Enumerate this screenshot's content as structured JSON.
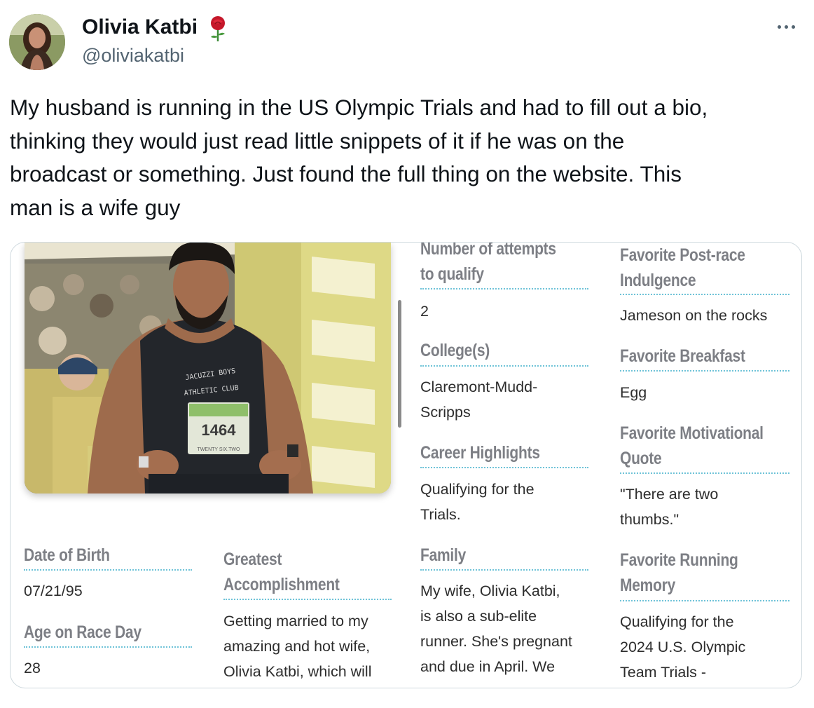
{
  "tweet": {
    "author": {
      "name": "Olivia Katbi",
      "handle": "@oliviakatbi",
      "name_emoji_icon": "rose-icon",
      "avatar_icon": "avatar-photo"
    },
    "more_icon": "ellipsis-icon",
    "text_lines": [
      "My husband is running in the US Olympic Trials and had to fill out a bio,",
      "thinking they would just read little snippets of it if he was on the",
      "broadcast or something. Just found the full thing on the website. This",
      "man is a wife guy"
    ]
  },
  "bio": {
    "photo": {
      "bib_number": "1464",
      "bib_footer": "TWENTY SIX.TWO",
      "jersey_line1": "JACUZZI BOYS",
      "jersey_line2": "ATHLETIC CLUB"
    },
    "fields": {
      "attempts": {
        "label": [
          "Number of attempts",
          "to qualify"
        ],
        "value": [
          "2"
        ]
      },
      "post_race": {
        "label": [
          "Favorite Post-race",
          "Indulgence"
        ],
        "value": [
          "Jameson on the rocks"
        ]
      },
      "college": {
        "label": [
          "College(s)"
        ],
        "value": [
          "Claremont-Mudd-",
          "Scripps"
        ]
      },
      "breakfast": {
        "label": [
          "Favorite Breakfast"
        ],
        "value": [
          "Egg"
        ]
      },
      "highlights": {
        "label": [
          "Career Highlights"
        ],
        "value": [
          "Qualifying for the",
          "Trials."
        ]
      },
      "quote": {
        "label": [
          "Favorite Motivational",
          "Quote"
        ],
        "value": [
          "\"There are two",
          "thumbs.\""
        ]
      },
      "dob": {
        "label": [
          "Date of Birth"
        ],
        "value": [
          "07/21/95"
        ]
      },
      "accomplishment": {
        "label": [
          "Greatest",
          "Accomplishment"
        ],
        "value": [
          "Getting married to my",
          "amazing and hot wife,",
          "Olivia Katbi, which will"
        ]
      },
      "family": {
        "label": [
          "Family"
        ],
        "value": [
          "My wife, Olivia Katbi,",
          "is also a sub-elite",
          "runner. She's pregnant",
          "and due in April. We"
        ]
      },
      "running_memory": {
        "label": [
          "Favorite Running",
          "Memory"
        ],
        "value": [
          "Qualifying for the",
          "2024 U.S. Olympic",
          "Team Trials -"
        ]
      },
      "age": {
        "label": [
          "Age on Race Day"
        ],
        "value": [
          "28"
        ]
      }
    }
  },
  "colors": {
    "label_gray": "#7d7f85",
    "underline_teal": "#6fc3d8",
    "value_text": "#2d2d2d",
    "handle_gray": "#536471",
    "text_black": "#0f1419"
  }
}
